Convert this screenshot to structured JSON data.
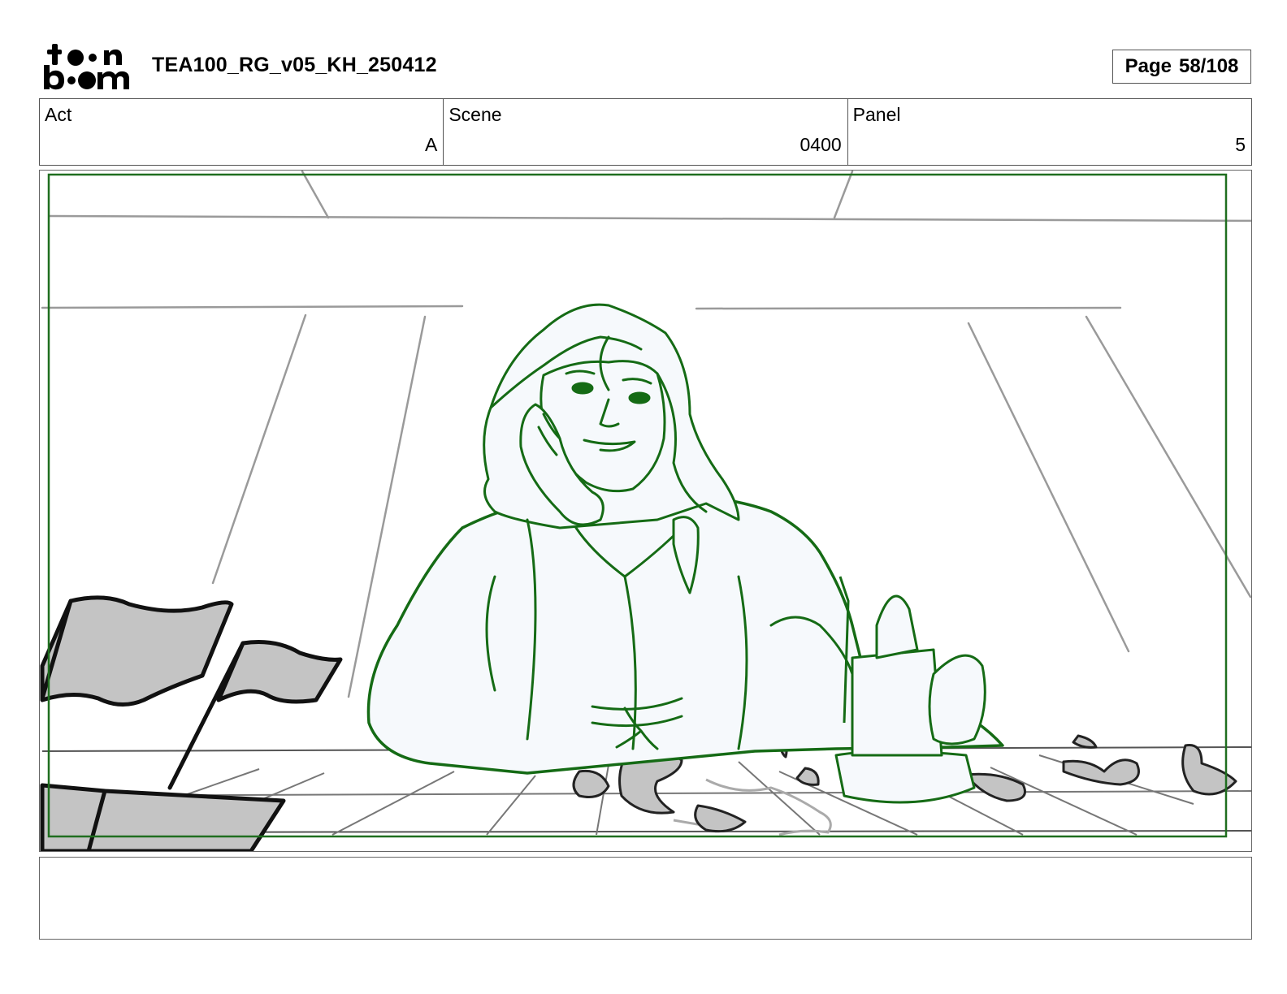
{
  "header": {
    "logo_text_top": "toon",
    "logo_text_bottom": "boom",
    "title": "TEA100_RG_v05_KH_250412",
    "page_label": "Page",
    "page_number": "58/108"
  },
  "meta": {
    "act_label": "Act",
    "act_value": "A",
    "scene_label": "Scene",
    "scene_value": "0400",
    "panel_label": "Panel",
    "panel_value": "5"
  },
  "panel": {
    "safe_frame_color": "#1f6e1f",
    "character_line_color": "#156b15",
    "background_line_color": "#9a9a9a",
    "prop_fill_color": "#c4c4c4"
  },
  "notes": {
    "text": ""
  }
}
